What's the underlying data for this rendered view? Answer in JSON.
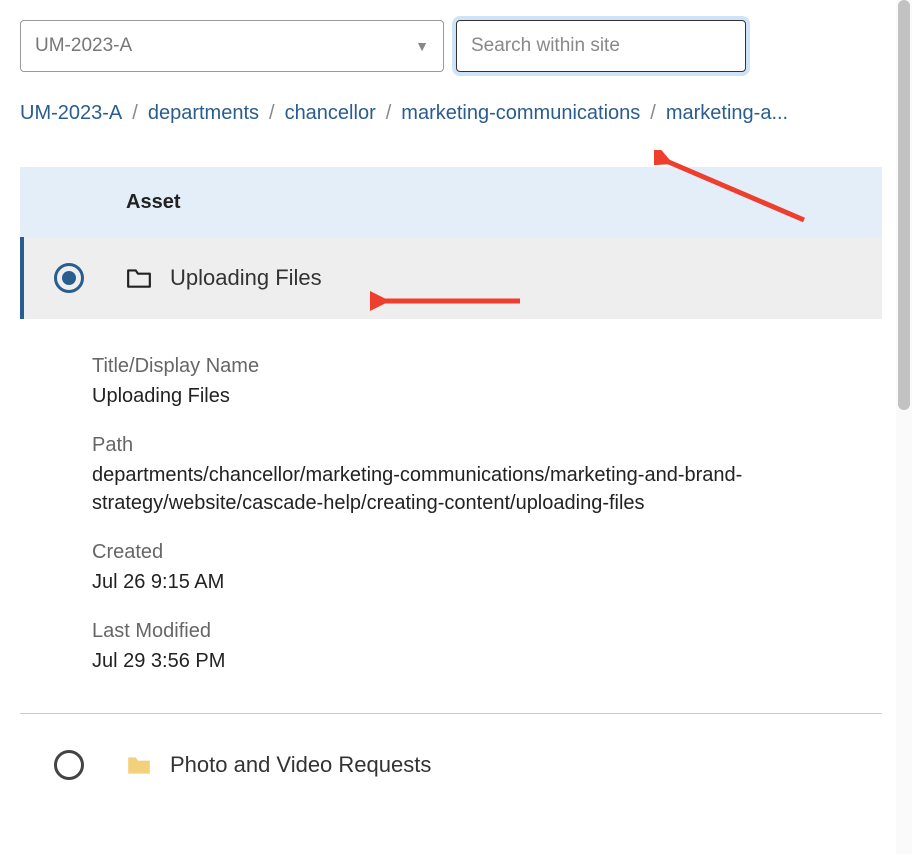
{
  "topbar": {
    "site_select_value": "UM-2023-A",
    "search_placeholder": "Search within site"
  },
  "breadcrumb": {
    "items": [
      {
        "label": "UM-2023-A"
      },
      {
        "label": "departments"
      },
      {
        "label": "chancellor"
      },
      {
        "label": "marketing-communications"
      },
      {
        "label": "marketing-a..."
      }
    ]
  },
  "table": {
    "header_label": "Asset",
    "rows": [
      {
        "selected": true,
        "icon": "folder-outline",
        "label": "Uploading Files"
      },
      {
        "selected": false,
        "icon": "folder-solid",
        "label": "Photo and Video Requests"
      }
    ]
  },
  "details": {
    "title_label": "Title/Display Name",
    "title_value": "Uploading Files",
    "path_label": "Path",
    "path_value": "departments/chancellor/marketing-communications/marketing-and-brand-strategy/website/cascade-help/creating-content/uploading-files",
    "created_label": "Created",
    "created_value": "Jul 26 9:15 AM",
    "modified_label": "Last Modified",
    "modified_value": "Jul 29 3:56 PM"
  },
  "colors": {
    "link": "#2a5d8f",
    "header_bg": "#e3eef8",
    "folder_yellow": "#f3d17c"
  }
}
